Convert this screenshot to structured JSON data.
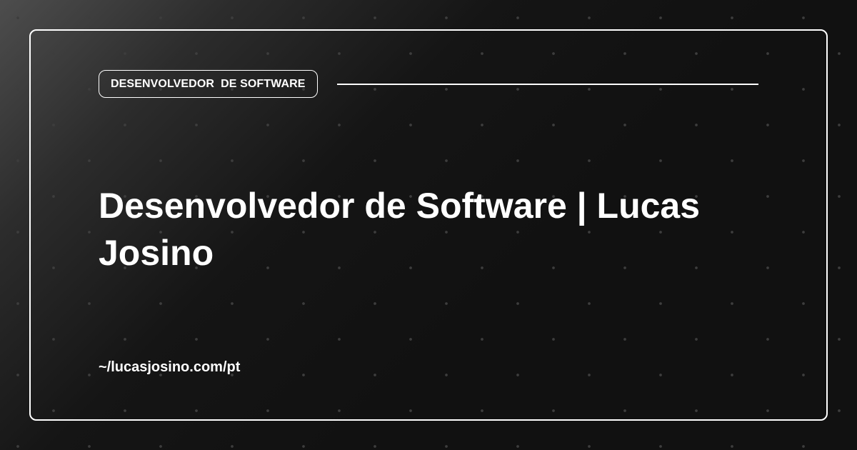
{
  "badge": {
    "label": "DESENVOLVEDOR  DE SOFTWARE"
  },
  "title": "Desenvolvedor de Software | Lucas Josino",
  "url": "~/lucasjosino.com/pt",
  "colors": {
    "background": "#111111",
    "accent": "#ffffff",
    "dots": "#3d3d3d"
  }
}
